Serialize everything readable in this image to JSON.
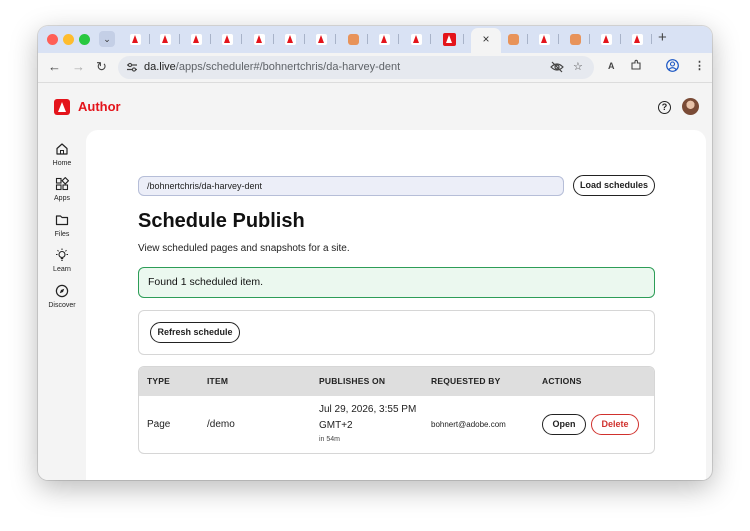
{
  "browser": {
    "active_tab_close": "×",
    "new_tab": "+",
    "url_host": "da.live",
    "url_path": "/apps/scheduler#/bohnertchris/da-harvey-dent"
  },
  "app": {
    "title": "Author",
    "help": "?"
  },
  "sidenav": {
    "items": [
      {
        "label": "Home"
      },
      {
        "label": "Apps"
      },
      {
        "label": "Files"
      },
      {
        "label": "Learn"
      },
      {
        "label": "Discover"
      }
    ]
  },
  "main": {
    "path_input_value": "/bohnertchris/da-harvey-dent",
    "load_button": "Load schedules",
    "title": "Schedule Publish",
    "subtitle": "View scheduled pages and snapshots for a site.",
    "found_message": "Found 1 scheduled item.",
    "refresh_button": "Refresh schedule",
    "table": {
      "headers": [
        "TYPE",
        "ITEM",
        "PUBLISHES ON",
        "REQUESTED BY",
        "ACTIONS"
      ],
      "rows": [
        {
          "type": "Page",
          "item": "/demo",
          "publishes_on_line1": "Jul 29, 2026, 3:55 PM",
          "publishes_on_line2": "GMT+2",
          "relative": "in 54m",
          "requested_by": "bohnert@adobe.com",
          "open": "Open",
          "delete": "Delete"
        }
      ]
    }
  },
  "colors": {
    "brand": "#e4141b",
    "success_border": "#2d9d57",
    "success_bg": "#ebf8ef",
    "danger": "#d0312d"
  }
}
